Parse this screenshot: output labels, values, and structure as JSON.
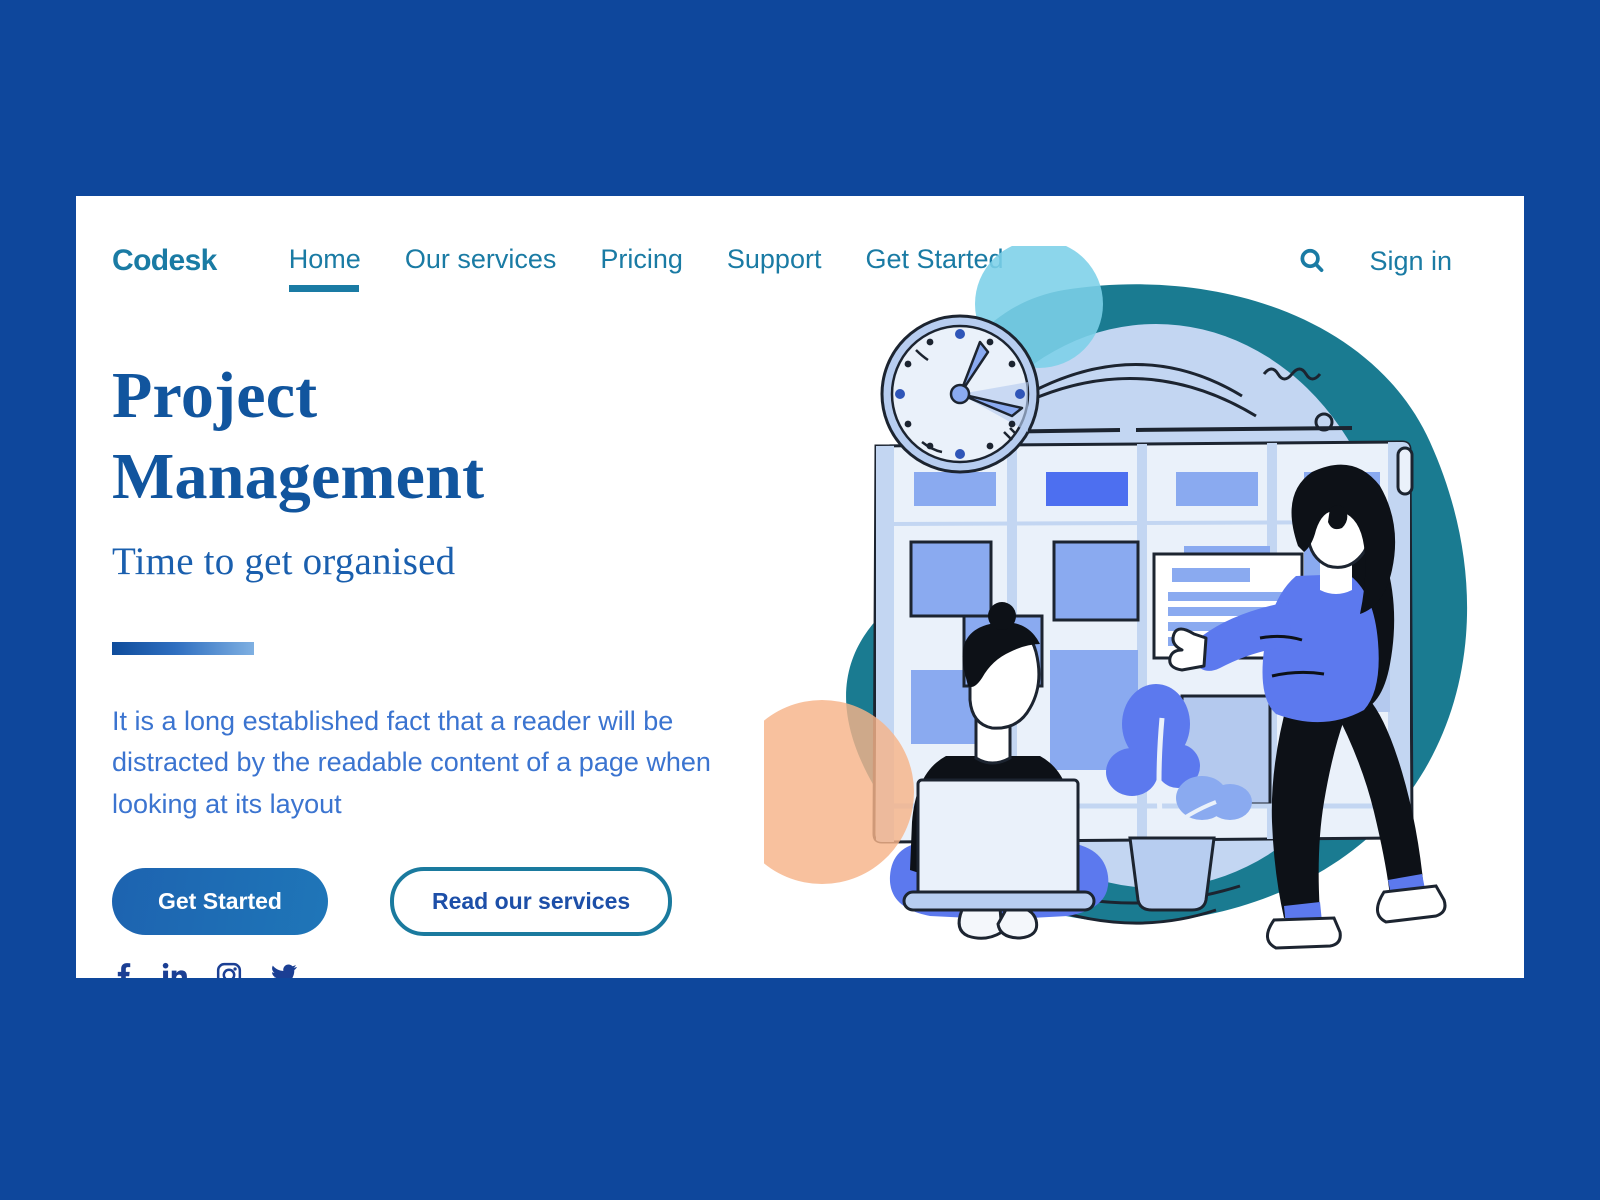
{
  "page": {
    "background_color": "#0e479c",
    "card_background": "#ffffff"
  },
  "nav": {
    "brand": "Codesk",
    "brand_color": "#1a7ba4",
    "links": [
      {
        "label": "Home",
        "active": true
      },
      {
        "label": "Our services",
        "active": false
      },
      {
        "label": "Pricing",
        "active": false
      },
      {
        "label": "Support",
        "active": false
      },
      {
        "label": "Get Started",
        "active": false
      }
    ],
    "search_icon": "search-icon",
    "signin_label": "Sign in"
  },
  "hero": {
    "headline_line1": "Project",
    "headline_line2": "Management",
    "subheadline": "Time to get organised",
    "headline_color": "#11559e",
    "divider_from": "#0f4c9b",
    "divider_to": "#7fb0e2",
    "body": "It is a long established fact that a reader will be distracted by the readable content of a page when looking at its layout",
    "body_color": "#3b74d0",
    "primary_button": "Get Started",
    "secondary_button": "Read our services",
    "primary_button_color": "#1d63b0",
    "secondary_button_border": "#1a7a9e"
  },
  "social": [
    {
      "name": "facebook-icon",
      "label": "Facebook"
    },
    {
      "name": "linkedin-icon",
      "label": "LinkedIn"
    },
    {
      "name": "instagram-icon",
      "label": "Instagram"
    },
    {
      "name": "twitter-icon",
      "label": "Twitter"
    }
  ],
  "illustration": {
    "name": "project-management-illustration",
    "blob_color": "#1a7b91",
    "accent_circle_light_blue": "#7cd0e8",
    "accent_circle_peach": "#f7c49c",
    "board_color": "#c3d6f2",
    "card_blue": "#8aaaf0",
    "card_blue_strong": "#4d6ff0",
    "person_shirt": "#5c79ee",
    "clock_face": "#e8f0fa",
    "alt": "Two people organising tasks on a large kanban board with a wall clock and a plant"
  }
}
